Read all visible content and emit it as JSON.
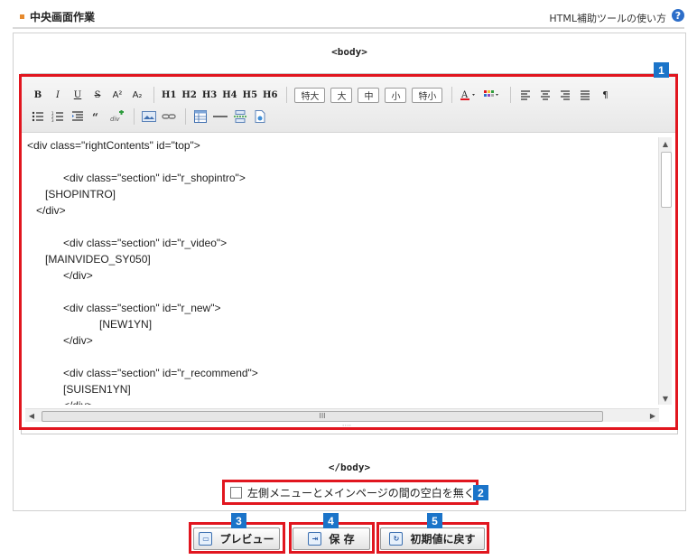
{
  "header": {
    "title": "中央画面作業",
    "help_link": "HTML補助ツールの使い方",
    "help_icon_text": "?"
  },
  "editor": {
    "open_tag": "<body>",
    "close_tag": "</body>",
    "toolbar": {
      "format_buttons": [
        "B",
        "I",
        "U",
        "S",
        "A²",
        "A₂"
      ],
      "heading_buttons": [
        "H1",
        "H2",
        "H3",
        "H4",
        "H5",
        "H6"
      ],
      "size_buttons": [
        "特大",
        "大",
        "中",
        "小",
        "特小"
      ],
      "pilcrow": "¶"
    },
    "code_lines": [
      "<div class=\"rightContents\" id=\"top\">",
      "",
      "            <div class=\"section\" id=\"r_shopintro\">",
      "      [SHOPINTRO]",
      "   </div>",
      "",
      "            <div class=\"section\" id=\"r_video\">",
      "      [MAINVIDEO_SY050]",
      "            </div>",
      "",
      "            <div class=\"section\" id=\"r_new\">",
      "                        [NEW1YN]",
      "            </div>",
      "",
      "            <div class=\"section\" id=\"r_recommend\">",
      "            [SUISEN1YN]",
      "            </div>"
    ],
    "hscroll_grip": "III"
  },
  "option": {
    "checkbox_label": "左側メニューとメインページの間の空白を無くす",
    "checked": false
  },
  "buttons": {
    "preview": "プレビュー",
    "save": "保 存",
    "reset": "初期値に戻す"
  },
  "badges": [
    "1",
    "2",
    "3",
    "4",
    "5"
  ],
  "colors": {
    "highlight": "#e1161f",
    "badge": "#1b74c9",
    "title_bullet": "#e68a2e"
  }
}
